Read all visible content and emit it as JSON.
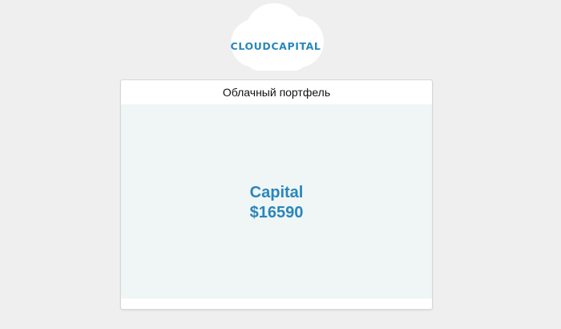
{
  "logo": {
    "text": "CLOUDCAPITAL",
    "icon": "cloud-icon",
    "color": "#2a86bb"
  },
  "portfolio": {
    "title": "Облачный портфель",
    "capital_label": "Capital",
    "capital_value": "$16590"
  },
  "colors": {
    "accent": "#2a86bb",
    "page_background": "#efeff0",
    "panel_background": "#f0f6f6"
  }
}
